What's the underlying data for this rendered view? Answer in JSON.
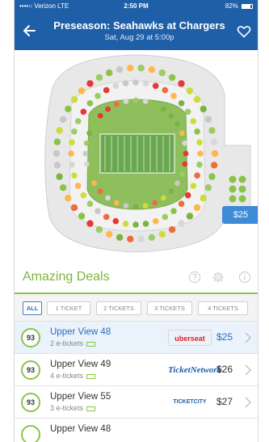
{
  "status_bar": {
    "carrier": "••••○ Verizon  LTE",
    "time": "2:50 PM",
    "battery": "82%"
  },
  "nav": {
    "title": "Preseason: Seahawks at Chargers",
    "subtitle": "Sat, Aug 29 at 5:00p",
    "back_icon": "back-arrow-icon",
    "favorite_icon": "heart-outline-icon"
  },
  "map": {
    "price_tag": "$25"
  },
  "deals": {
    "title": "Amazing Deals",
    "help_icon": "question-circle-icon",
    "settings_icon": "gear-icon",
    "info_icon": "info-circle-icon"
  },
  "filters": [
    "ALL",
    "1 TICKET",
    "2 TICKETS",
    "3 TICKETS",
    "4 TICKETS"
  ],
  "listings": [
    {
      "score": "93",
      "section": "Upper View 48",
      "tickets": "2 e-tickets",
      "seller": "uberseat",
      "price": "$25"
    },
    {
      "score": "93",
      "section": "Upper View 49",
      "tickets": "4 e-tickets",
      "seller": "TicketNetwork",
      "price": "$26"
    },
    {
      "score": "93",
      "section": "Upper View 55",
      "tickets": "3 e-tickets",
      "seller": "TICKETCITY",
      "price": "$27"
    },
    {
      "score": "",
      "section": "Upper View 48",
      "tickets": "",
      "seller": "",
      "price": ""
    }
  ],
  "colors": {
    "nav_blue": "#1f5fa8",
    "accent_green": "#8fc24b",
    "link_blue": "#2a6fc0",
    "field_green": "#6aa84f"
  }
}
